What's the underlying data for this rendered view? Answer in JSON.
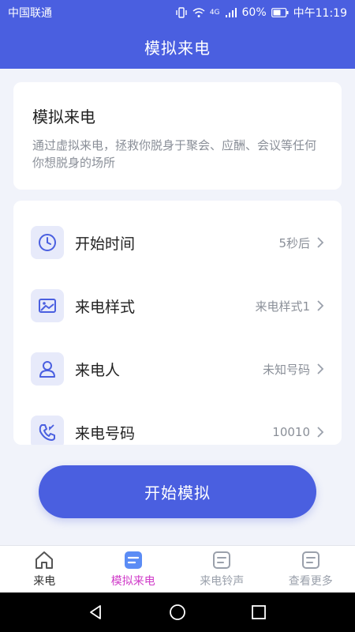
{
  "status_bar": {
    "carrier": "中国联通",
    "network": "4G",
    "battery": "60%",
    "time": "中午11:19"
  },
  "header": {
    "title": "模拟来电"
  },
  "intro": {
    "title": "模拟来电",
    "description": "通过虚拟来电，拯救你脱身于聚会、应酬、会议等任何你想脱身的场所"
  },
  "settings": [
    {
      "label": "开始时间",
      "value": "5秒后",
      "icon": "clock-icon"
    },
    {
      "label": "来电样式",
      "value": "来电样式1",
      "icon": "image-icon"
    },
    {
      "label": "来电人",
      "value": "未知号码",
      "icon": "person-icon"
    },
    {
      "label": "来电号码",
      "value": "10010",
      "icon": "phone-icon"
    }
  ],
  "start_button": {
    "label": "开始模拟"
  },
  "tabs": [
    {
      "label": "来电",
      "icon": "home-icon"
    },
    {
      "label": "模拟来电",
      "icon": "list-icon",
      "active": true
    },
    {
      "label": "来电铃声",
      "icon": "list-icon"
    },
    {
      "label": "查看更多",
      "icon": "list-icon"
    }
  ],
  "colors": {
    "primary": "#4a5fe0",
    "active_tab": "#d03cc9",
    "icon_bg": "#e7eafa"
  }
}
